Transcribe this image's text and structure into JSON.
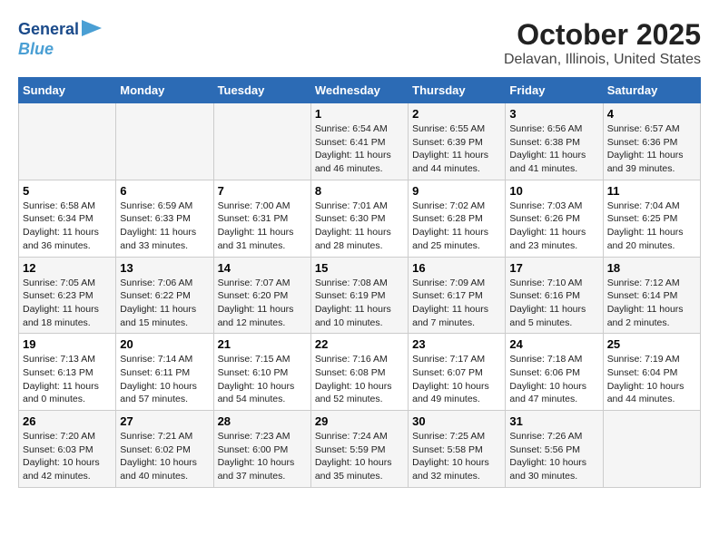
{
  "logo": {
    "line1": "General",
    "line2": "Blue"
  },
  "title": "October 2025",
  "subtitle": "Delavan, Illinois, United States",
  "weekdays": [
    "Sunday",
    "Monday",
    "Tuesday",
    "Wednesday",
    "Thursday",
    "Friday",
    "Saturday"
  ],
  "weeks": [
    [
      {
        "day": "",
        "info": ""
      },
      {
        "day": "",
        "info": ""
      },
      {
        "day": "",
        "info": ""
      },
      {
        "day": "1",
        "info": "Sunrise: 6:54 AM\nSunset: 6:41 PM\nDaylight: 11 hours and 46 minutes."
      },
      {
        "day": "2",
        "info": "Sunrise: 6:55 AM\nSunset: 6:39 PM\nDaylight: 11 hours and 44 minutes."
      },
      {
        "day": "3",
        "info": "Sunrise: 6:56 AM\nSunset: 6:38 PM\nDaylight: 11 hours and 41 minutes."
      },
      {
        "day": "4",
        "info": "Sunrise: 6:57 AM\nSunset: 6:36 PM\nDaylight: 11 hours and 39 minutes."
      }
    ],
    [
      {
        "day": "5",
        "info": "Sunrise: 6:58 AM\nSunset: 6:34 PM\nDaylight: 11 hours and 36 minutes."
      },
      {
        "day": "6",
        "info": "Sunrise: 6:59 AM\nSunset: 6:33 PM\nDaylight: 11 hours and 33 minutes."
      },
      {
        "day": "7",
        "info": "Sunrise: 7:00 AM\nSunset: 6:31 PM\nDaylight: 11 hours and 31 minutes."
      },
      {
        "day": "8",
        "info": "Sunrise: 7:01 AM\nSunset: 6:30 PM\nDaylight: 11 hours and 28 minutes."
      },
      {
        "day": "9",
        "info": "Sunrise: 7:02 AM\nSunset: 6:28 PM\nDaylight: 11 hours and 25 minutes."
      },
      {
        "day": "10",
        "info": "Sunrise: 7:03 AM\nSunset: 6:26 PM\nDaylight: 11 hours and 23 minutes."
      },
      {
        "day": "11",
        "info": "Sunrise: 7:04 AM\nSunset: 6:25 PM\nDaylight: 11 hours and 20 minutes."
      }
    ],
    [
      {
        "day": "12",
        "info": "Sunrise: 7:05 AM\nSunset: 6:23 PM\nDaylight: 11 hours and 18 minutes."
      },
      {
        "day": "13",
        "info": "Sunrise: 7:06 AM\nSunset: 6:22 PM\nDaylight: 11 hours and 15 minutes."
      },
      {
        "day": "14",
        "info": "Sunrise: 7:07 AM\nSunset: 6:20 PM\nDaylight: 11 hours and 12 minutes."
      },
      {
        "day": "15",
        "info": "Sunrise: 7:08 AM\nSunset: 6:19 PM\nDaylight: 11 hours and 10 minutes."
      },
      {
        "day": "16",
        "info": "Sunrise: 7:09 AM\nSunset: 6:17 PM\nDaylight: 11 hours and 7 minutes."
      },
      {
        "day": "17",
        "info": "Sunrise: 7:10 AM\nSunset: 6:16 PM\nDaylight: 11 hours and 5 minutes."
      },
      {
        "day": "18",
        "info": "Sunrise: 7:12 AM\nSunset: 6:14 PM\nDaylight: 11 hours and 2 minutes."
      }
    ],
    [
      {
        "day": "19",
        "info": "Sunrise: 7:13 AM\nSunset: 6:13 PM\nDaylight: 11 hours and 0 minutes."
      },
      {
        "day": "20",
        "info": "Sunrise: 7:14 AM\nSunset: 6:11 PM\nDaylight: 10 hours and 57 minutes."
      },
      {
        "day": "21",
        "info": "Sunrise: 7:15 AM\nSunset: 6:10 PM\nDaylight: 10 hours and 54 minutes."
      },
      {
        "day": "22",
        "info": "Sunrise: 7:16 AM\nSunset: 6:08 PM\nDaylight: 10 hours and 52 minutes."
      },
      {
        "day": "23",
        "info": "Sunrise: 7:17 AM\nSunset: 6:07 PM\nDaylight: 10 hours and 49 minutes."
      },
      {
        "day": "24",
        "info": "Sunrise: 7:18 AM\nSunset: 6:06 PM\nDaylight: 10 hours and 47 minutes."
      },
      {
        "day": "25",
        "info": "Sunrise: 7:19 AM\nSunset: 6:04 PM\nDaylight: 10 hours and 44 minutes."
      }
    ],
    [
      {
        "day": "26",
        "info": "Sunrise: 7:20 AM\nSunset: 6:03 PM\nDaylight: 10 hours and 42 minutes."
      },
      {
        "day": "27",
        "info": "Sunrise: 7:21 AM\nSunset: 6:02 PM\nDaylight: 10 hours and 40 minutes."
      },
      {
        "day": "28",
        "info": "Sunrise: 7:23 AM\nSunset: 6:00 PM\nDaylight: 10 hours and 37 minutes."
      },
      {
        "day": "29",
        "info": "Sunrise: 7:24 AM\nSunset: 5:59 PM\nDaylight: 10 hours and 35 minutes."
      },
      {
        "day": "30",
        "info": "Sunrise: 7:25 AM\nSunset: 5:58 PM\nDaylight: 10 hours and 32 minutes."
      },
      {
        "day": "31",
        "info": "Sunrise: 7:26 AM\nSunset: 5:56 PM\nDaylight: 10 hours and 30 minutes."
      },
      {
        "day": "",
        "info": ""
      }
    ]
  ]
}
